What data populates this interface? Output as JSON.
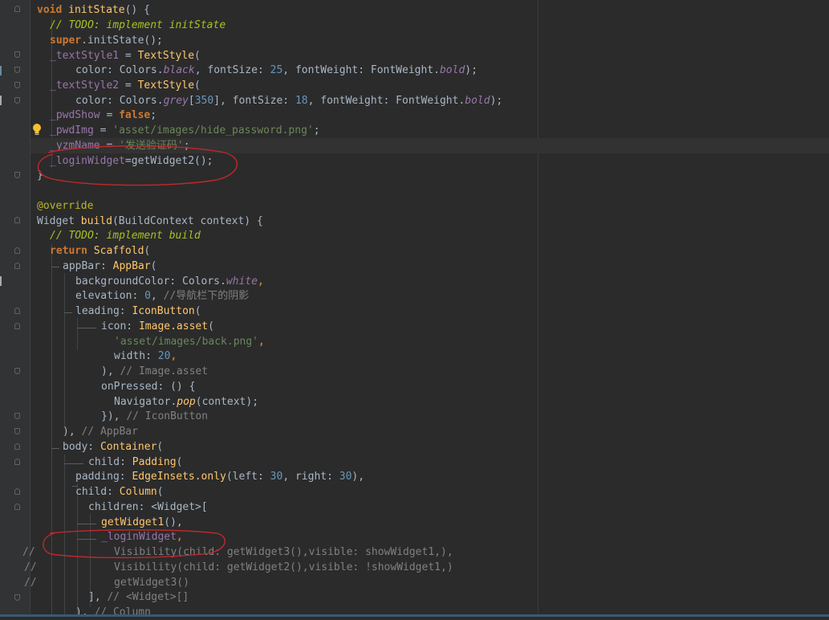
{
  "editor": {
    "language": "Dart",
    "theme": "Darcula"
  },
  "code": {
    "initState_sig": [
      "void ",
      "initState",
      "() {"
    ],
    "l2_comment": "// TODO: implement initState",
    "l3": [
      "super",
      ".initState();"
    ],
    "l4": [
      "_textStyle1",
      " = ",
      "TextStyle",
      "("
    ],
    "l5": [
      "color: Colors.",
      "black",
      ", fontSize: ",
      "25",
      ", fontWeight: FontWeight.",
      "bold",
      ");"
    ],
    "l6": [
      "_textStyle2",
      " = ",
      "TextStyle",
      "("
    ],
    "l7": [
      "color: Colors.",
      "grey",
      "[",
      "350",
      "], fontSize: ",
      "18",
      ", fontWeight: FontWeight.",
      "bold",
      ");"
    ],
    "l8": [
      "_pwdShow",
      " = ",
      "false",
      ";"
    ],
    "l9": [
      "_pwdImg",
      " = ",
      "'asset/images/hide_password.png'",
      ";"
    ],
    "l10": [
      "_yzmName",
      " = ",
      "'发送验证码'",
      ";"
    ],
    "l11": [
      "_loginWidget",
      "=",
      "getWidget2",
      "();"
    ],
    "l12": "}",
    "l14": "@override",
    "l15": [
      "Widget ",
      "build",
      "(BuildContext context) {"
    ],
    "l16_comment": "// TODO: implement build",
    "l17": [
      "return ",
      "Scaffold",
      "("
    ],
    "l18": [
      "appBar: ",
      "AppBar",
      "("
    ],
    "l19": [
      "backgroundColor: Colors.",
      "white",
      ","
    ],
    "l20": [
      "elevation: ",
      "0",
      ", ",
      "//导航栏下的阴影"
    ],
    "l21": [
      "leading: ",
      "IconButton",
      "("
    ],
    "l22": [
      "icon: ",
      "Image.asset",
      "("
    ],
    "l23": [
      "'asset/images/back.png'",
      ","
    ],
    "l24": [
      "width: ",
      "20",
      ","
    ],
    "l25": [
      "), ",
      "// Image.asset"
    ],
    "l26": [
      "onPressed: () {"
    ],
    "l27": [
      "Navigator.",
      "pop",
      "(context);"
    ],
    "l28": [
      "}), ",
      "// IconButton"
    ],
    "l29": [
      "), ",
      "// AppBar"
    ],
    "l30": [
      "body: ",
      "Container",
      "("
    ],
    "l31": [
      "child: ",
      "Padding",
      "("
    ],
    "l32": [
      "padding: ",
      "EdgeInsets.",
      "only",
      "(left: ",
      "30",
      ", right: ",
      "30",
      "),"
    ],
    "l33": [
      "child: ",
      "Column",
      "("
    ],
    "l34": [
      "children: <Widget>["
    ],
    "l35": [
      "getWidget1",
      "(),"
    ],
    "l36": [
      "_loginWidget",
      ","
    ],
    "l37": [
      "//",
      "Visibility(child: getWidget3(),visible: showWidget1,),"
    ],
    "l38": [
      "//",
      "Visibility(child: getWidget2(),visible: !showWidget1,)"
    ],
    "l39": [
      "//",
      "getWidget3()"
    ],
    "l40": [
      "], ",
      "// <Widget>[]"
    ],
    "l41": [
      "), ",
      "// Column"
    ]
  },
  "colors": {
    "background": "#2b2b2b",
    "gutter": "#313335",
    "keyword": "#cc7832",
    "function": "#ffc66d",
    "field": "#9876aa",
    "number": "#6897bb",
    "string": "#6a8759",
    "comment": "#808080",
    "todo": "#a8c023",
    "annotation": "#bbb529",
    "circle_annotation": "#c0282c"
  },
  "icons": [
    "lightbulb-icon",
    "fold-marker-icon"
  ]
}
